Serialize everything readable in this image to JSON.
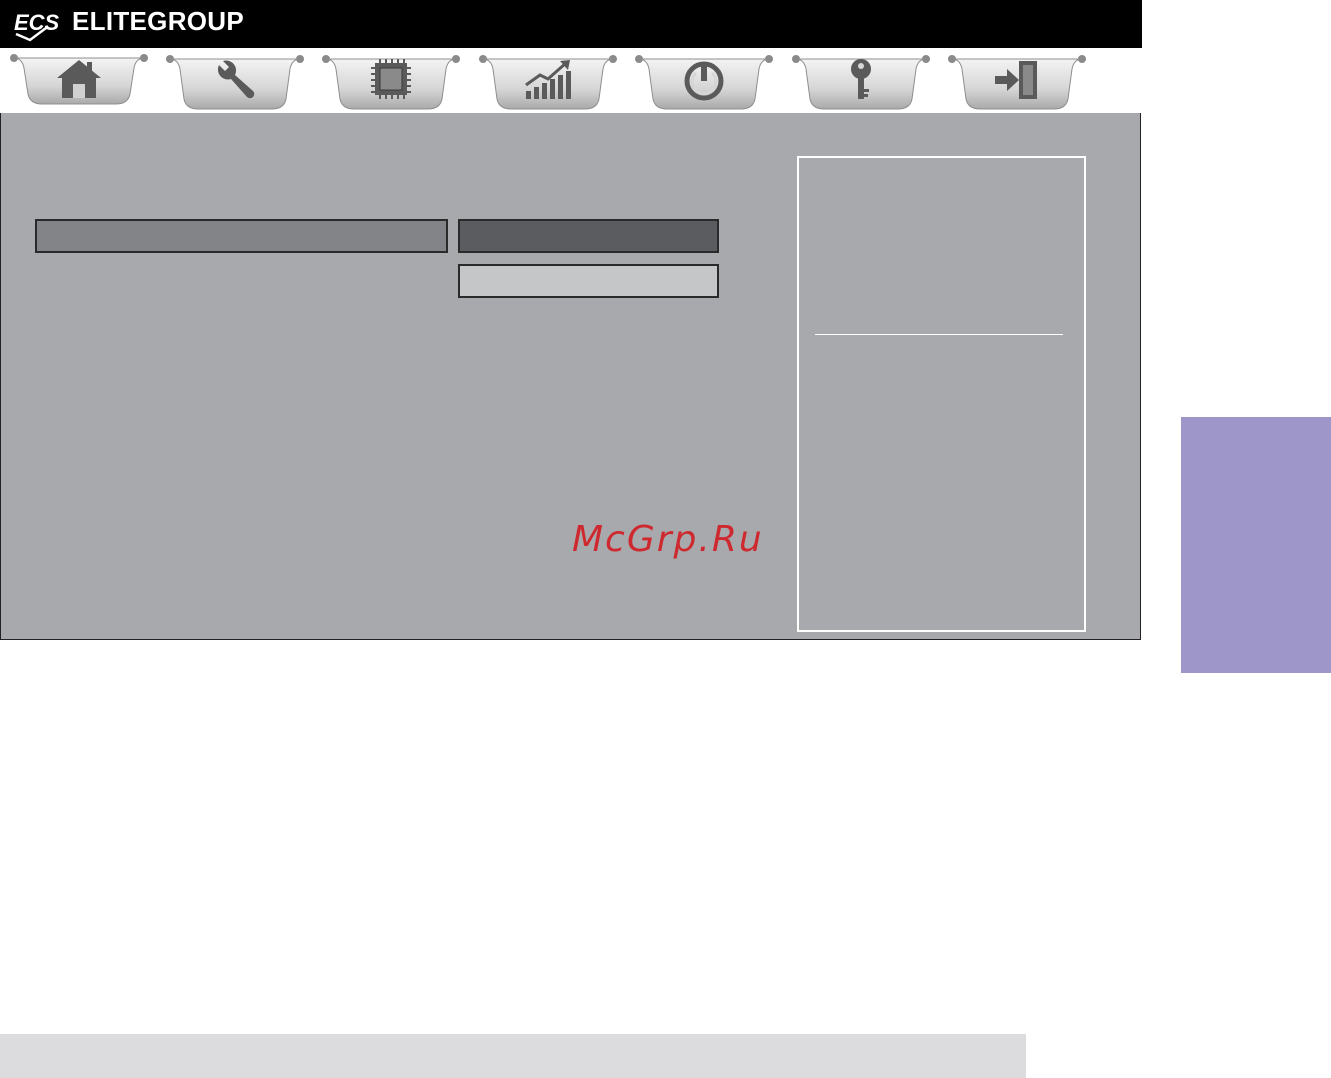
{
  "brand": {
    "logo_text": "ECS",
    "name": "ELITEGROUP"
  },
  "tabs": [
    {
      "icon": "home-icon",
      "label": ""
    },
    {
      "icon": "wrench-icon",
      "label": ""
    },
    {
      "icon": "chip-icon",
      "label": ""
    },
    {
      "icon": "performance-chart-icon",
      "label": ""
    },
    {
      "icon": "power-icon",
      "label": ""
    },
    {
      "icon": "key-icon",
      "label": ""
    },
    {
      "icon": "exit-icon",
      "label": ""
    }
  ],
  "main": {
    "watermark": "McGrp.Ru"
  },
  "colors": {
    "panel": "#a8a9ad",
    "selected_row": "#838487",
    "value_dark": "#5b5c5f",
    "value_light": "#c5c6c8",
    "side_tab": "#9e96c8",
    "watermark": "#d2232a"
  }
}
